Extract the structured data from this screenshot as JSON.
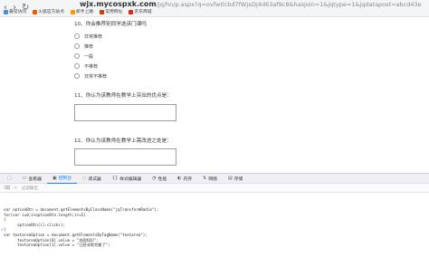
{
  "browser": {
    "back": "‹",
    "forward": "›",
    "refresh": "↻",
    "url_host": "wjx.mycospxk.com",
    "url_rest": "/jq/hn/p.aspx?q=ovfwtlcbd7fWjxDj4d63af9c8&amp;hasjoin=1&amp;jqtype=1&amp;jqdatapost=abcd43e",
    "bookmarks": [
      {
        "label": "最常访问",
        "color": "#4a90d9"
      },
      {
        "label": "火狐官方站点",
        "color": "#e66000"
      },
      {
        "label": "新手上路",
        "color": "#ff9500"
      },
      {
        "label": "常用网址",
        "color": "#d83b01"
      },
      {
        "label": "京东商城",
        "color": "#e1251b"
      }
    ]
  },
  "questions": [
    {
      "title": "10、你会推荐别同学选该门课吗",
      "options": [
        "非常推荐",
        "推荐",
        "一般",
        "不推荐",
        "非常不推荐"
      ]
    },
    {
      "title": "11、你认为该教师在教学上突出的优点是："
    },
    {
      "title": "12、你认为该教师在教学上需改进之处是："
    }
  ],
  "devtools": {
    "tabs": [
      {
        "label": "查看器",
        "icon": "▭"
      },
      {
        "label": "控制台",
        "icon": "▣"
      },
      {
        "label": "调试器",
        "icon": "◌"
      },
      {
        "label": "样式编辑器",
        "icon": "{}"
      },
      {
        "label": "性能",
        "icon": "◔"
      },
      {
        "label": "内存",
        "icon": "◐"
      },
      {
        "label": "网络",
        "icon": "⇅"
      },
      {
        "label": "存储",
        "icon": "▤"
      }
    ],
    "active_tab": "控制台",
    "filter_placeholder": "过滤输出",
    "console_lines": [
      "var optionBtn = document.getElementsByClassName(\"jqTransformRadio\");",
      "for(var i=0;i<optionBtn.length;i+=5)",
      "{",
      "      optionBtn[i].click();",
      "}",
      "var textareaOption = document.getElementsByTagName(\"textarea\");",
      "      textareaOption[0].value = \"巩固知识\";",
      "      textareaOption[1].value = \"已经非常完美了\";"
    ],
    "prompt_symbol": "»"
  }
}
